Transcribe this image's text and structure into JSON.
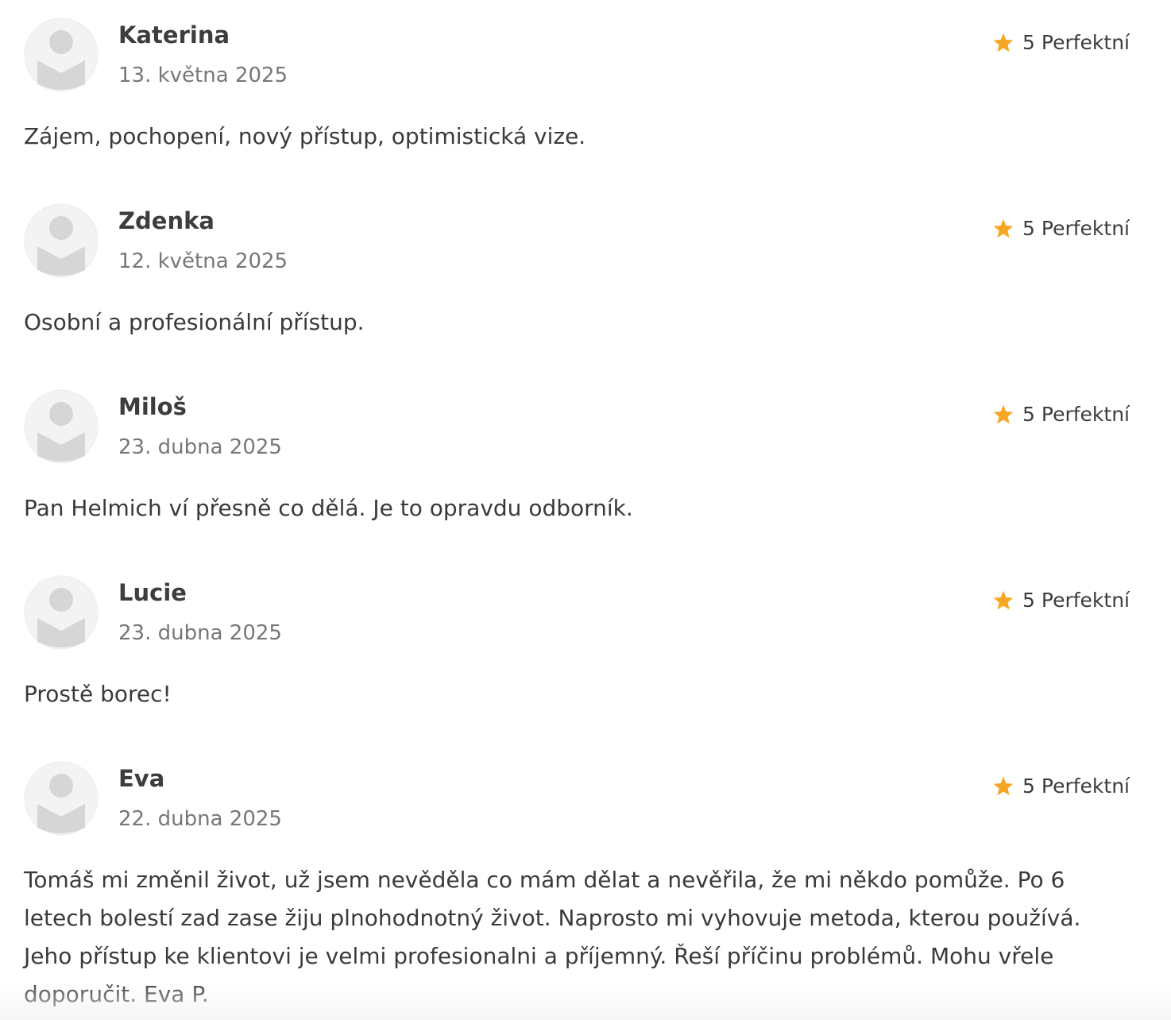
{
  "reviews": [
    {
      "name": "Katerina",
      "date": "13. května 2025",
      "rating_text": "5 Perfektní",
      "text": "Zájem, pochopení, nový přístup, optimistická vize."
    },
    {
      "name": "Zdenka",
      "date": "12. května 2025",
      "rating_text": "5 Perfektní",
      "text": "Osobní a profesionální přístup."
    },
    {
      "name": "Miloš",
      "date": "23. dubna 2025",
      "rating_text": "5 Perfektní",
      "text": "Pan Helmich ví přesně co dělá. Je to opravdu odborník."
    },
    {
      "name": "Lucie",
      "date": "23. dubna 2025",
      "rating_text": "5 Perfektní",
      "text": "Prostě borec!"
    },
    {
      "name": "Eva",
      "date": "22. dubna 2025",
      "rating_text": "5 Perfektní",
      "text": "Tomáš mi změnil život, už jsem nevěděla co mám dělat a nevěřila, že mi někdo pomůže. Po 6 letech bolestí zad zase žiju plnohodnotný život. Naprosto mi vyhovuje metoda, kterou používá. Jeho přístup ke klientovi je velmi profesionalni a příjemný. Řeší příčinu problémů. Mohu vřele doporučit. Eva P."
    }
  ],
  "colors": {
    "star": "#f5a623",
    "avatar_bg": "#f2f2f2",
    "avatar_figure": "#d5d5d5",
    "name": "#3d3d3d",
    "date": "#777777",
    "text": "#3a3a3a"
  },
  "icons": {
    "avatar": "user-placeholder-icon",
    "rating": "star-icon"
  }
}
